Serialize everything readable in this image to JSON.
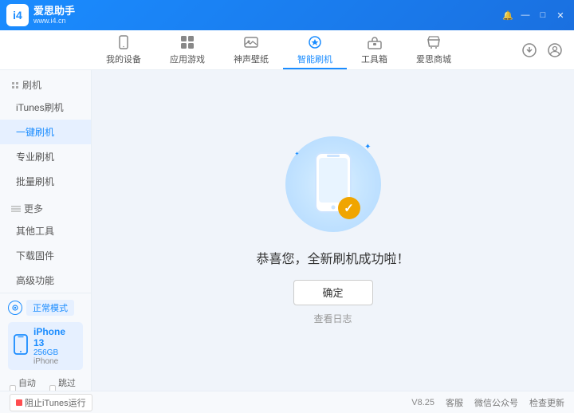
{
  "app": {
    "logo_text": "爱思助手",
    "logo_url": "www.i4.cn",
    "logo_letter": "i4"
  },
  "titlebar": {
    "controls": [
      "minimize",
      "maximize",
      "close"
    ],
    "icons": [
      "download",
      "user"
    ]
  },
  "nav": {
    "items": [
      {
        "id": "my-device",
        "label": "我的设备",
        "icon": "device"
      },
      {
        "id": "apps-games",
        "label": "应用游戏",
        "icon": "apps"
      },
      {
        "id": "wallpaper",
        "label": "神声壁纸",
        "icon": "wallpaper"
      },
      {
        "id": "smart-flash",
        "label": "智能刷机",
        "icon": "smart-flash",
        "active": true
      },
      {
        "id": "toolbox",
        "label": "工具箱",
        "icon": "toolbox"
      },
      {
        "id": "store",
        "label": "爱思商城",
        "icon": "store"
      }
    ]
  },
  "sidebar": {
    "section1": {
      "title": "刷机",
      "items": [
        {
          "id": "itunes-flash",
          "label": "iTunes刷机"
        },
        {
          "id": "onekey-flash",
          "label": "一键刷机",
          "active": true
        },
        {
          "id": "pro-flash",
          "label": "专业刷机"
        },
        {
          "id": "batch-flash",
          "label": "批量刷机"
        }
      ]
    },
    "section2": {
      "title": "更多",
      "items": [
        {
          "id": "other-tools",
          "label": "其他工具"
        },
        {
          "id": "download-fw",
          "label": "下载固件"
        },
        {
          "id": "advanced",
          "label": "高级功能"
        }
      ]
    }
  },
  "device": {
    "mode_label": "正常模式",
    "name": "iPhone 13",
    "storage": "256GB",
    "type": "iPhone",
    "checkbox1": "自动激活",
    "checkbox2": "跳过向导"
  },
  "content": {
    "success_message": "恭喜您，全新刷机成功啦！",
    "confirm_btn": "确定",
    "view_log": "查看日志"
  },
  "footer": {
    "stop_btn": "阻止iTunes运行",
    "version": "V8.25",
    "support": "客服",
    "wechat": "微信公众号",
    "check_update": "检查更新"
  }
}
